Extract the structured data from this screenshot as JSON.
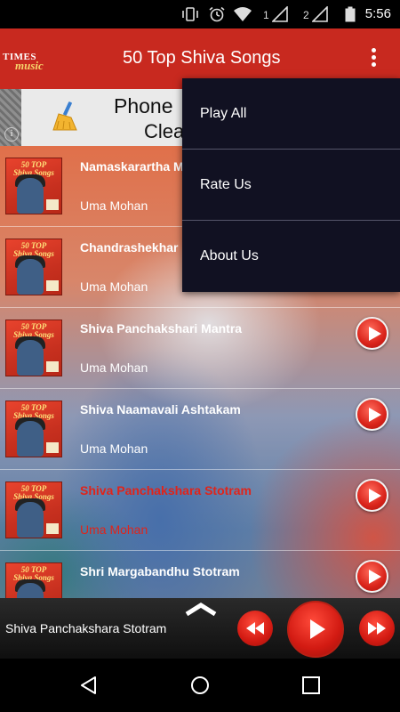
{
  "status_bar": {
    "time": "5:56",
    "sim1": "1",
    "sim2": "2",
    "icons": [
      "vibrate-icon",
      "alarm-icon",
      "wifi-icon",
      "signal-icon",
      "battery-icon"
    ]
  },
  "app_bar": {
    "logo_line1": "TIMES",
    "logo_line2": "music",
    "title": "50 Top Shiva Songs",
    "brand_color": "#c8291f"
  },
  "ad": {
    "line1": "Phone",
    "line2": "Clea",
    "info": "i"
  },
  "menu": {
    "items": [
      {
        "label": "Play All"
      },
      {
        "label": "Rate Us"
      },
      {
        "label": "About Us"
      }
    ]
  },
  "songs": [
    {
      "title": "Namaskarartha M",
      "artist": "Uma Mohan",
      "active": false
    },
    {
      "title": "Chandrashekhar",
      "artist": "Uma Mohan",
      "active": false
    },
    {
      "title": "Shiva Panchakshari Mantra",
      "artist": "Uma Mohan",
      "active": false
    },
    {
      "title": "Shiva Naamavali Ashtakam",
      "artist": "Uma Mohan",
      "active": false
    },
    {
      "title": "Shiva Panchakshara Stotram",
      "artist": "Uma Mohan",
      "active": true
    },
    {
      "title": "Shri Margabandhu Stotram",
      "artist": "",
      "active": false
    }
  ],
  "thumbnail": {
    "text_line1": "50 TOP",
    "text_line2": "Shiva Songs"
  },
  "player": {
    "now_playing": "Shiva Panchakshara Stotram",
    "accent": "#d21a12"
  },
  "nav": {
    "icons": [
      "back-icon",
      "home-icon",
      "recents-icon"
    ]
  }
}
